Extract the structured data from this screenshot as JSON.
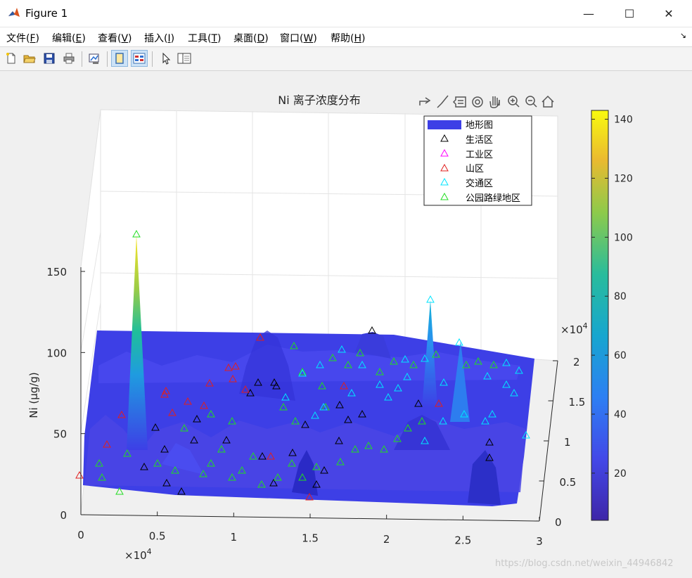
{
  "window": {
    "title": "Figure 1",
    "minimize_glyph": "—",
    "maximize_glyph": "☐",
    "close_glyph": "✕"
  },
  "menu": {
    "items": [
      {
        "label": "文件(",
        "key": "F",
        "end": ")"
      },
      {
        "label": "编辑(",
        "key": "E",
        "end": ")"
      },
      {
        "label": "查看(",
        "key": "V",
        "end": ")"
      },
      {
        "label": "插入(",
        "key": "I",
        "end": ")"
      },
      {
        "label": "工具(",
        "key": "T",
        "end": ")"
      },
      {
        "label": "桌面(",
        "key": "D",
        "end": ")"
      },
      {
        "label": "窗口(",
        "key": "W",
        "end": ")"
      },
      {
        "label": "帮助(",
        "key": "H",
        "end": ")"
      }
    ],
    "overflow_glyph": "↘"
  },
  "toolbar": {
    "icons": [
      "new-figure-icon",
      "open-icon",
      "save-icon",
      "print-icon",
      "link-plot-icon",
      "hide-plot-tools-icon",
      "show-plot-tools-icon",
      "edit-plot-icon",
      "property-inspector-icon"
    ]
  },
  "colors": {
    "surface": "#3d3fe6",
    "colorbar_low": "#3e26a8",
    "colorbar_high": "#f9fb0e",
    "living": "#000000",
    "industrial": "#ff00ff",
    "mountain": "#e0201f",
    "traffic": "#00e5ff",
    "park": "#22dd22"
  },
  "chart_data": {
    "type": "surface",
    "title": "Ni 离子浓度分布",
    "xlabel": "",
    "ylabel": "",
    "zlabel": "Ni (μg/g)",
    "x_exponent": "×10",
    "x_exponent_power": "4",
    "y_exponent": "×10",
    "y_exponent_power": "4",
    "xlim": [
      0,
      30000
    ],
    "ylim": [
      0,
      20000
    ],
    "zlim": [
      0,
      200
    ],
    "x_ticks": [
      "0",
      "0.5",
      "1",
      "1.5",
      "2",
      "2.5",
      "3"
    ],
    "y_ticks": [
      "0",
      "0.5",
      "1",
      "1.5",
      "2"
    ],
    "z_ticks": [
      "0",
      "50",
      "100",
      "150"
    ],
    "colorbar": {
      "range": [
        4,
        143
      ],
      "ticks": [
        "20",
        "40",
        "60",
        "80",
        "100",
        "120",
        "140"
      ]
    },
    "peaks": [
      {
        "x": 3000,
        "y": 6000,
        "z": 185
      },
      {
        "x": 23500,
        "y": 13000,
        "z": 130
      },
      {
        "x": 25000,
        "y": 11000,
        "z": 100
      },
      {
        "x": 19000,
        "y": 15000,
        "z": 110
      }
    ],
    "legend": {
      "location": "top-right",
      "entries": [
        "地形图",
        "生活区",
        "工业区",
        "山区",
        "交通区",
        "公园路绿地区"
      ]
    },
    "series": [
      {
        "name": "地形图",
        "marker": "surface"
      },
      {
        "name": "生活区",
        "marker": "triangle"
      },
      {
        "name": "工业区",
        "marker": "triangle"
      },
      {
        "name": "山区",
        "marker": "triangle"
      },
      {
        "name": "交通区",
        "marker": "triangle"
      },
      {
        "name": "公园路绿地区",
        "marker": "triangle"
      }
    ]
  },
  "watermark": "https://blog.csdn.net/weixin_44946842"
}
